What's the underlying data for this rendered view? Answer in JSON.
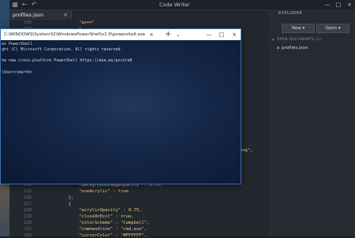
{
  "code_writer": {
    "title": "Code Writer",
    "tab_label": "profiles.json",
    "tab_close": "×",
    "icons": {
      "app": "app-grid-icon",
      "back": "back-arrow-icon",
      "undo": "undo-icon"
    },
    "window_controls": [
      "—",
      "□",
      "×"
    ],
    "editor_lines": [
      {
        "num": "196",
        "text": "                \"ax+=\""
      },
      {
        "num": "197",
        "text": "                }"
      },
      {
        "num": "224",
        "text": "                \"backgroundImageOpacity\" : 0.75,"
      },
      {
        "num": "225",
        "text": "                \"useAcrylic\" : true"
      },
      {
        "num": "226",
        "text": "            },"
      },
      {
        "num": "227",
        "text": "            {"
      },
      {
        "num": "228",
        "text": "                \"acrylicOpacity\" : 0.75,"
      },
      {
        "num": "229",
        "text": "                \"closeOnExit\" : true,"
      },
      {
        "num": "230",
        "text": "                \"colorScheme\" : \"Campbell\","
      },
      {
        "num": "231",
        "text": "                \"commandline\" : \"cmd.exe\","
      },
      {
        "num": "232",
        "text": "                \"cursorColor\" : \"#FFFFFF\","
      }
    ],
    "partial_line": "ƒ).png\","
  },
  "explorer": {
    "title": "EXPLORER",
    "new_label": "New",
    "open_label": "Open",
    "section_label": "OPEN DOCUMENTS (1)",
    "file_name": "profiles.json"
  },
  "powershell": {
    "title": "C:\\WINDOWS\\System32\\WindowsPowerShell\\v1.0\\powershell.exe",
    "lines": [
      "ws PowerShell",
      "ght (C) Microsoft Corporation. All rights reserved.",
      "",
      "he new cross-platform PowerShell https://aka.ms/pscore6",
      "",
      "\\Users\\marth>"
    ]
  },
  "colors": {
    "accent": "#3c6fb5",
    "editor_bg": "#23272e",
    "ps_bg": "#0c1a35"
  }
}
